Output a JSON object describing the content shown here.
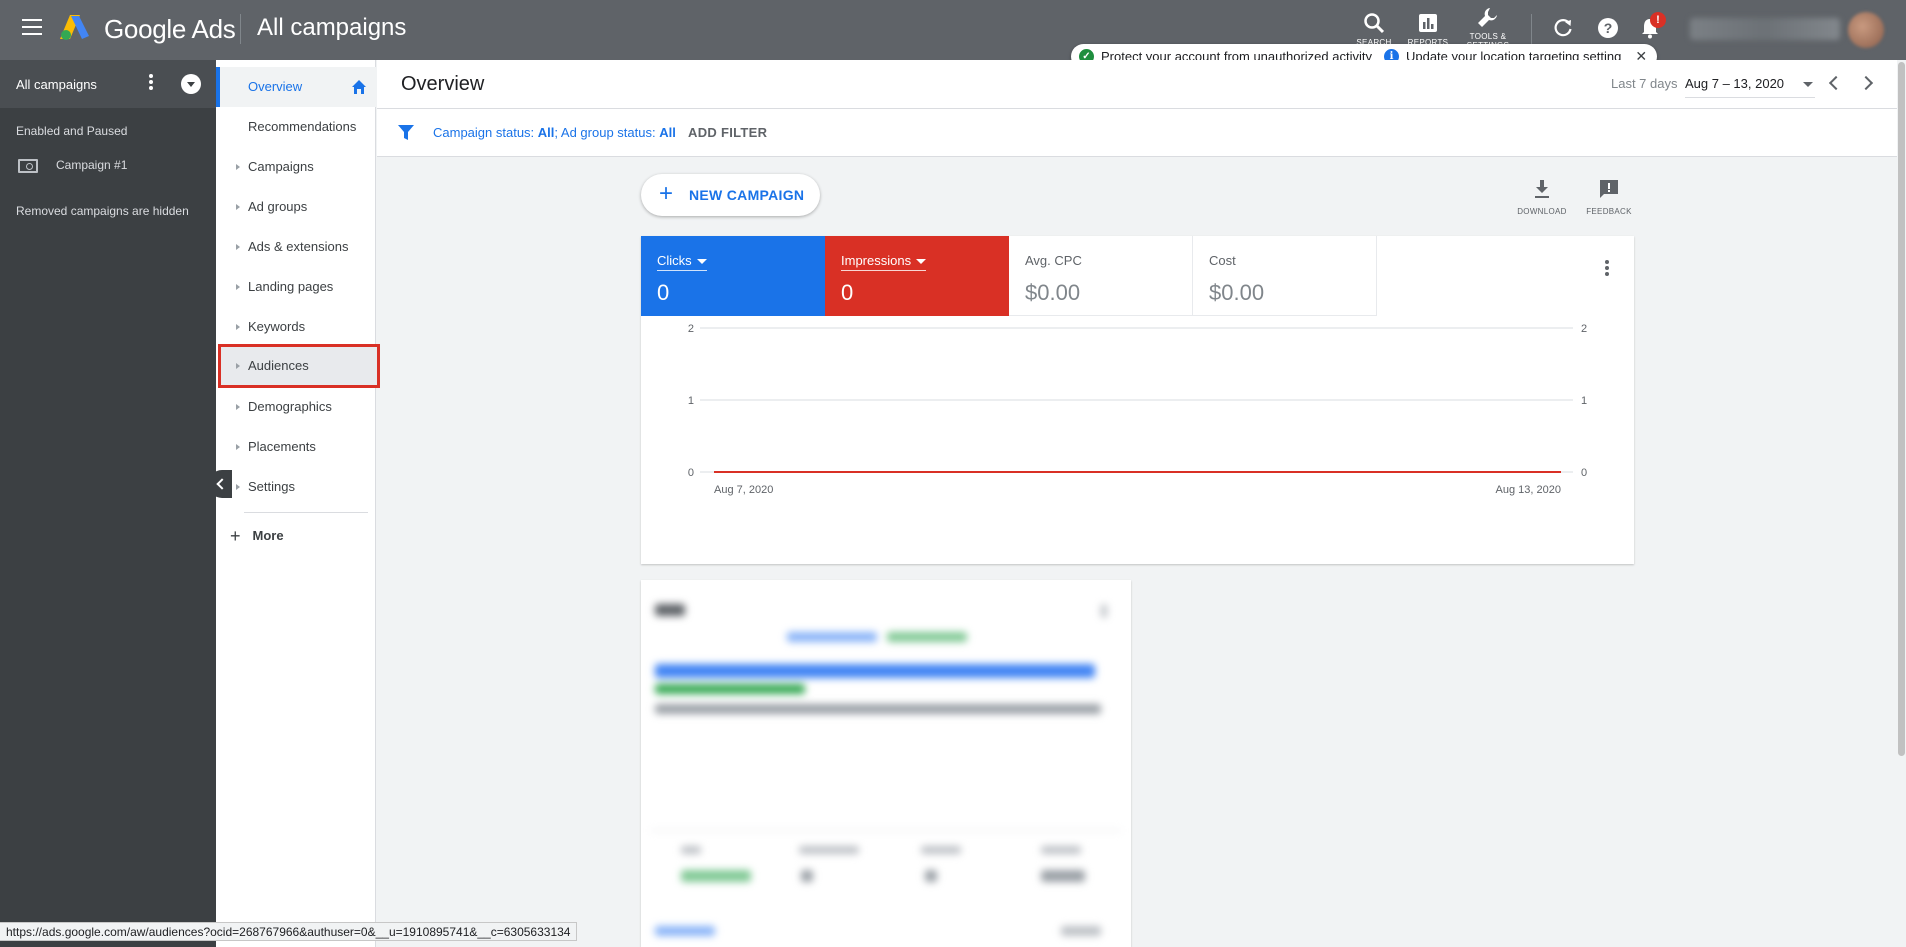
{
  "app": {
    "brand": "Google Ads",
    "title": "All campaigns"
  },
  "toolbar": {
    "search_label": "SEARCH",
    "reports_label": "REPORTS",
    "tools_label": "TOOLS & SETTINGS",
    "notification_badge": "!"
  },
  "notices": {
    "security": "Protect your account from unauthorized activity",
    "location": "Update your location targeting setting"
  },
  "campaign_panel": {
    "header": "All campaigns",
    "section": "Enabled and Paused",
    "campaigns": [
      "Campaign #1"
    ],
    "removed_note": "Removed campaigns are hidden"
  },
  "nav": {
    "items": [
      {
        "label": "Overview",
        "active": true
      },
      {
        "label": "Recommendations"
      },
      {
        "label": "Campaigns"
      },
      {
        "label": "Ad groups"
      },
      {
        "label": "Ads & extensions"
      },
      {
        "label": "Landing pages"
      },
      {
        "label": "Keywords"
      },
      {
        "label": "Audiences",
        "highlighted": true
      },
      {
        "label": "Demographics"
      },
      {
        "label": "Placements"
      },
      {
        "label": "Settings"
      }
    ],
    "more_label": "More"
  },
  "header": {
    "page_title": "Overview",
    "date_label": "Last 7 days",
    "date_range": "Aug 7 – 13, 2020"
  },
  "filter": {
    "status_prefix": "Campaign status: ",
    "status_value": "All",
    "sep": "; Ad group status: ",
    "adgroup_value": "All",
    "add_filter": "ADD FILTER"
  },
  "actions": {
    "new_campaign": "NEW CAMPAIGN",
    "download": "DOWNLOAD",
    "feedback": "FEEDBACK"
  },
  "metrics": [
    {
      "name": "Clicks",
      "value": "0",
      "color": "#1a73e8"
    },
    {
      "name": "Impressions",
      "value": "0",
      "color": "#d93025"
    },
    {
      "name": "Avg. CPC",
      "value": "$0.00"
    },
    {
      "name": "Cost",
      "value": "$0.00"
    }
  ],
  "chart_data": {
    "type": "line",
    "x": [
      "Aug 7, 2020",
      "Aug 13, 2020"
    ],
    "y_ticks": [
      0,
      1,
      2
    ],
    "ylim": [
      0,
      2
    ],
    "series": [
      {
        "name": "Clicks",
        "values": [
          0,
          0
        ],
        "color": "#1a73e8"
      },
      {
        "name": "Impressions",
        "values": [
          0,
          0
        ],
        "color": "#d93025"
      }
    ],
    "grid": true
  },
  "status_bar": {
    "url": "https://ads.google.com/aw/audiences?ocid=268767966&authuser=0&__u=1910895741&__c=6305633134"
  }
}
